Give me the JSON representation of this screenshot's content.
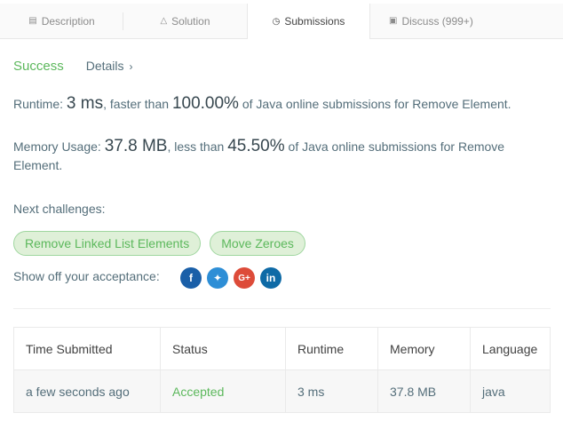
{
  "tabs": [
    {
      "label": "Description",
      "icon": "document-icon"
    },
    {
      "label": "Solution",
      "icon": "flask-icon"
    },
    {
      "label": "Submissions",
      "icon": "clock-icon"
    },
    {
      "label": "Discuss (999+)",
      "icon": "comment-icon"
    }
  ],
  "result": {
    "status": "Success",
    "details": "Details"
  },
  "runtime": {
    "label": "Runtime:",
    "value": "3 ms",
    "mid": ", faster than",
    "pct": "100.00%",
    "suffix": "of Java online submissions for Remove Element."
  },
  "memory": {
    "label": "Memory Usage:",
    "value": "37.8 MB",
    "mid": ", less than",
    "pct": "45.50%",
    "suffix": "of Java online submissions for Remove Element."
  },
  "next": {
    "label": "Next challenges:",
    "items": [
      "Remove Linked List Elements",
      "Move Zeroes"
    ]
  },
  "share": {
    "label": "Show off your acceptance:"
  },
  "table": {
    "headers": [
      "Time Submitted",
      "Status",
      "Runtime",
      "Memory",
      "Language"
    ],
    "rows": [
      [
        "a few seconds ago",
        "Accepted",
        "3 ms",
        "37.8 MB",
        "java"
      ]
    ]
  }
}
